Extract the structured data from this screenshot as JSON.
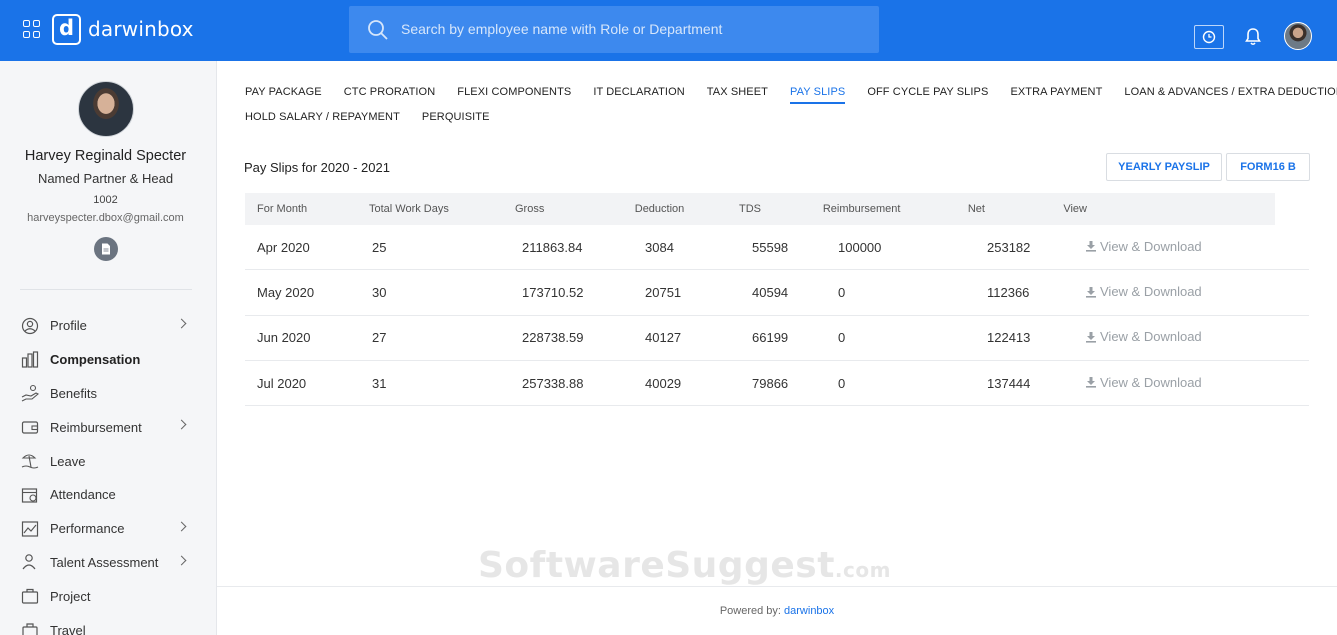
{
  "app": {
    "brand": "darwinbox",
    "logo_letter": "d"
  },
  "search": {
    "placeholder": "Search by employee name with Role or Department"
  },
  "profile": {
    "name": "Harvey Reginald Specter",
    "role": "Named Partner & Head",
    "employee_id": "1002",
    "email": "harveyspecter.dbox@gmail.com"
  },
  "sidebar": {
    "items": [
      {
        "label": "Profile",
        "icon": "user-circle-icon",
        "has_chevron": true
      },
      {
        "label": "Compensation",
        "icon": "compensation-icon",
        "active": true
      },
      {
        "label": "Benefits",
        "icon": "hand-benefits-icon"
      },
      {
        "label": "Reimbursement",
        "icon": "wallet-icon",
        "has_chevron": true
      },
      {
        "label": "Leave",
        "icon": "beach-leave-icon"
      },
      {
        "label": "Attendance",
        "icon": "calendar-clock-icon"
      },
      {
        "label": "Performance",
        "icon": "chart-line-icon",
        "has_chevron": true
      },
      {
        "label": "Talent Assessment",
        "icon": "person-assessment-icon",
        "has_chevron": true
      },
      {
        "label": "Project",
        "icon": "briefcase-icon"
      },
      {
        "label": "Travel",
        "icon": "suitcase-icon"
      }
    ]
  },
  "tabs": {
    "row1": [
      "PAY PACKAGE",
      "CTC PRORATION",
      "FLEXI COMPONENTS",
      "IT DECLARATION",
      "TAX SHEET",
      "PAY SLIPS",
      "OFF CYCLE PAY SLIPS",
      "EXTRA PAYMENT",
      "LOAN & ADVANCES / EXTRA DEDUCTIONS"
    ],
    "row2": [
      "HOLD SALARY / REPAYMENT",
      "PERQUISITE"
    ],
    "active": "PAY SLIPS"
  },
  "payslips": {
    "title": "Pay Slips for 2020 - 2021",
    "yearly_button": "YEARLY PAYSLIP",
    "form16_button": "FORM16 B",
    "columns": [
      "For Month",
      "Total Work Days",
      "Gross",
      "Deduction",
      "TDS",
      "Reimbursement",
      "Net",
      "View"
    ],
    "rows": [
      {
        "month": "Apr 2020",
        "days": "25",
        "gross": "211863.84",
        "deduction": "3084",
        "tds": "55598",
        "reimbursement": "100000",
        "net": "253182",
        "view": "View & Download"
      },
      {
        "month": "May 2020",
        "days": "30",
        "gross": "173710.52",
        "deduction": "20751",
        "tds": "40594",
        "reimbursement": "0",
        "net": "112366",
        "view": "View & Download"
      },
      {
        "month": "Jun 2020",
        "days": "27",
        "gross": "228738.59",
        "deduction": "40127",
        "tds": "66199",
        "reimbursement": "0",
        "net": "122413",
        "view": "View & Download"
      },
      {
        "month": "Jul 2020",
        "days": "31",
        "gross": "257338.88",
        "deduction": "40029",
        "tds": "79866",
        "reimbursement": "0",
        "net": "137444",
        "view": "View & Download"
      }
    ]
  },
  "footer": {
    "prefix": "Powered by:",
    "link": "darwinbox"
  },
  "watermark": {
    "main": "SoftwareSuggest",
    "suffix": ".com"
  },
  "colors": {
    "brand_blue": "#1a73e8",
    "header_bg": "#1a73e8",
    "sidebar_bg": "#f5f6f8"
  }
}
